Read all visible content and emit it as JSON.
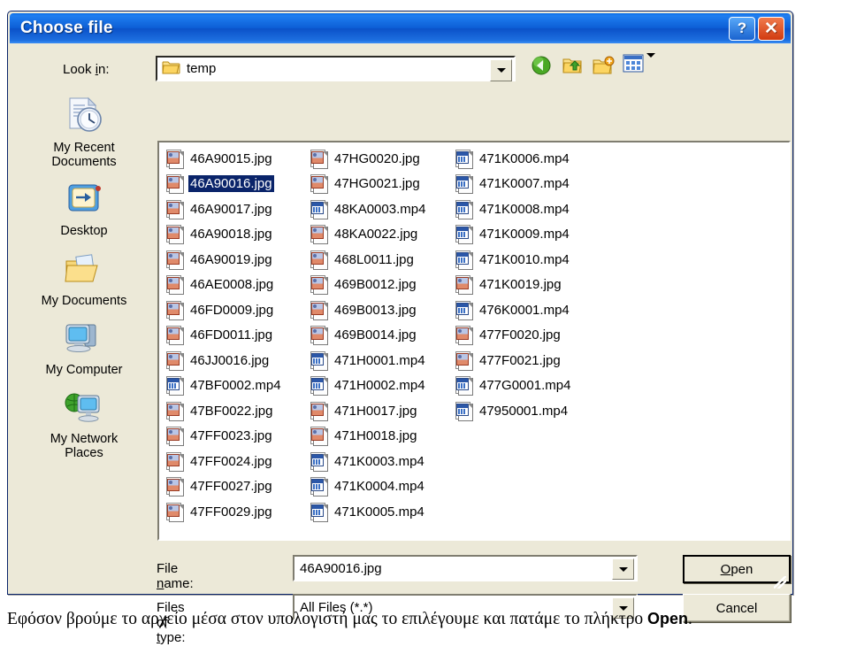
{
  "dialog": {
    "title": "Choose file",
    "titlebar_buttons": [
      {
        "name": "help-button",
        "label": "?"
      },
      {
        "name": "close-button",
        "label": "✕"
      }
    ],
    "lookin": {
      "label_pre": "Look ",
      "label_key": "i",
      "label_post": "n:",
      "value": "temp"
    },
    "toolbar": [
      {
        "name": "back-icon",
        "title": "Back"
      },
      {
        "name": "up-one-level-icon",
        "title": "Up One Level"
      },
      {
        "name": "new-folder-icon",
        "title": "Create New Folder"
      },
      {
        "name": "views-icon",
        "title": "Views"
      }
    ],
    "places": [
      {
        "name": "my-recent-documents",
        "label": "My Recent\nDocuments",
        "line1": "My Recent",
        "line2": "Documents"
      },
      {
        "name": "desktop",
        "label": "Desktop",
        "line1": "Desktop",
        "line2": ""
      },
      {
        "name": "my-documents",
        "label": "My Documents",
        "line1": "My Documents",
        "line2": ""
      },
      {
        "name": "my-computer",
        "label": "My Computer",
        "line1": "My Computer",
        "line2": ""
      },
      {
        "name": "my-network-places",
        "label": "My Network Places",
        "line1": "My Network",
        "line2": "Places"
      }
    ],
    "files": {
      "selected": "46A90016.jpg",
      "columns": [
        [
          {
            "name": "46A90015.jpg",
            "type": "jpg"
          },
          {
            "name": "46A90016.jpg",
            "type": "jpg"
          },
          {
            "name": "46A90017.jpg",
            "type": "jpg"
          },
          {
            "name": "46A90018.jpg",
            "type": "jpg"
          },
          {
            "name": "46A90019.jpg",
            "type": "jpg"
          },
          {
            "name": "46AE0008.jpg",
            "type": "jpg"
          },
          {
            "name": "46FD0009.jpg",
            "type": "jpg"
          },
          {
            "name": "46FD0011.jpg",
            "type": "jpg"
          },
          {
            "name": "46JJ0016.jpg",
            "type": "jpg"
          },
          {
            "name": "47BF0002.mp4",
            "type": "mp4"
          },
          {
            "name": "47BF0022.jpg",
            "type": "jpg"
          },
          {
            "name": "47FF0023.jpg",
            "type": "jpg"
          },
          {
            "name": "47FF0024.jpg",
            "type": "jpg"
          },
          {
            "name": "47FF0027.jpg",
            "type": "jpg"
          },
          {
            "name": "47FF0029.jpg",
            "type": "jpg"
          }
        ],
        [
          {
            "name": "47HG0020.jpg",
            "type": "jpg"
          },
          {
            "name": "47HG0021.jpg",
            "type": "jpg"
          },
          {
            "name": "48KA0003.mp4",
            "type": "mp4"
          },
          {
            "name": "48KA0022.jpg",
            "type": "jpg"
          },
          {
            "name": "468L0011.jpg",
            "type": "jpg"
          },
          {
            "name": "469B0012.jpg",
            "type": "jpg"
          },
          {
            "name": "469B0013.jpg",
            "type": "jpg"
          },
          {
            "name": "469B0014.jpg",
            "type": "jpg"
          },
          {
            "name": "471H0001.mp4",
            "type": "mp4"
          },
          {
            "name": "471H0002.mp4",
            "type": "mp4"
          },
          {
            "name": "471H0017.jpg",
            "type": "jpg"
          },
          {
            "name": "471H0018.jpg",
            "type": "jpg"
          },
          {
            "name": "471K0003.mp4",
            "type": "mp4"
          },
          {
            "name": "471K0004.mp4",
            "type": "mp4"
          },
          {
            "name": "471K0005.mp4",
            "type": "mp4"
          }
        ],
        [
          {
            "name": "471K0006.mp4",
            "type": "mp4"
          },
          {
            "name": "471K0007.mp4",
            "type": "mp4"
          },
          {
            "name": "471K0008.mp4",
            "type": "mp4"
          },
          {
            "name": "471K0009.mp4",
            "type": "mp4"
          },
          {
            "name": "471K0010.mp4",
            "type": "mp4"
          },
          {
            "name": "471K0019.jpg",
            "type": "jpg"
          },
          {
            "name": "476K0001.mp4",
            "type": "mp4"
          },
          {
            "name": "477F0020.jpg",
            "type": "jpg"
          },
          {
            "name": "477F0021.jpg",
            "type": "jpg"
          },
          {
            "name": "477G0001.mp4",
            "type": "mp4"
          },
          {
            "name": "47950001.mp4",
            "type": "mp4"
          }
        ]
      ]
    },
    "filename_field": {
      "label_pre": "File ",
      "label_key": "n",
      "label_post": "ame:",
      "value": "46A90016.jpg"
    },
    "filetype_field": {
      "label_pre": "Files of ",
      "label_key": "t",
      "label_post": "ype:",
      "value": "All Files (*.*)"
    },
    "buttons": {
      "open_pre": "",
      "open_key": "O",
      "open_post": "pen",
      "cancel": "Cancel"
    }
  },
  "caption": {
    "text": "Εφόσον βρούμε το αρχείο μέσα στον υπολογιστή μας το επιλέγουμε και πατάμε το πλήκτρο ",
    "bold": "Open",
    "tail": "."
  },
  "colors": {
    "titlebar_blue": "#0b52c9",
    "dialog_face": "#ece9d8",
    "selection_blue": "#0a246a",
    "close_red": "#d13a10"
  }
}
